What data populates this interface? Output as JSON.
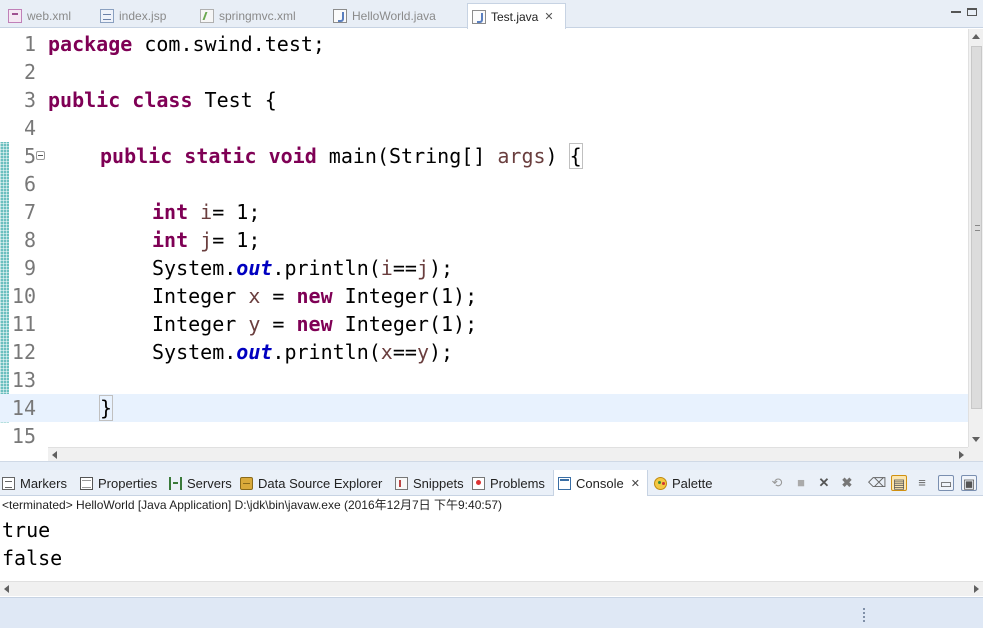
{
  "editor_tabs": [
    {
      "label": "web.xml",
      "icon": "xml-file-icon"
    },
    {
      "label": "index.jsp",
      "icon": "jsp-file-icon"
    },
    {
      "label": "springmvc.xml",
      "icon": "spring-xml-file-icon"
    },
    {
      "label": "HelloWorld.java",
      "icon": "java-file-icon"
    },
    {
      "label": "Test.java",
      "icon": "java-file-icon",
      "active": true,
      "close": "✕"
    }
  ],
  "code_lines": [
    {
      "num": "1"
    },
    {
      "num": "2"
    },
    {
      "num": "3"
    },
    {
      "num": "4"
    },
    {
      "num": "5"
    },
    {
      "num": "6"
    },
    {
      "num": "7"
    },
    {
      "num": "8"
    },
    {
      "num": "9"
    },
    {
      "num": "10"
    },
    {
      "num": "11"
    },
    {
      "num": "12"
    },
    {
      "num": "13"
    },
    {
      "num": "14"
    },
    {
      "num": "15"
    }
  ],
  "code": {
    "l1_kw": "package",
    "l1_rest": " com.swind.test;",
    "l3_kw": "public class",
    "l3_rest": " Test {",
    "l5_kw": "public static void",
    "l5_rest1": " main(String[] ",
    "l5_var": "args",
    "l5_rest2": ") ",
    "l5_brace": "{",
    "l7_kw": "int",
    "l7_var": "i",
    "l7_rest": "= 1;",
    "l8_kw": "int",
    "l8_var": "j",
    "l8_rest": "= 1;",
    "l9_a": "System.",
    "l9_fld": "out",
    "l9_b": ".println(",
    "l9_v1": "i",
    "l9_c": "==",
    "l9_v2": "j",
    "l9_d": ");",
    "l10_a": "Integer ",
    "l10_var": "x",
    "l10_b": " = ",
    "l10_kw": "new",
    "l10_c": " Integer(1);",
    "l11_a": "Integer ",
    "l11_var": "y",
    "l11_b": " = ",
    "l11_kw": "new",
    "l11_c": " Integer(1);",
    "l12_a": "System.",
    "l12_fld": "out",
    "l12_b": ".println(",
    "l12_v1": "x",
    "l12_c": "==",
    "l12_v2": "y",
    "l12_d": ");",
    "l14_brace": "}"
  },
  "view_tabs": [
    {
      "label": "Markers",
      "icon": "markers-icon"
    },
    {
      "label": "Properties",
      "icon": "properties-icon"
    },
    {
      "label": "Servers",
      "icon": "servers-icon"
    },
    {
      "label": "Data Source Explorer",
      "icon": "data-source-explorer-icon"
    },
    {
      "label": "Snippets",
      "icon": "snippets-icon"
    },
    {
      "label": "Problems",
      "icon": "problems-icon"
    },
    {
      "label": "Console",
      "icon": "console-icon",
      "active": true,
      "close": "✕"
    },
    {
      "label": "Palette",
      "icon": "palette-icon"
    }
  ],
  "console": {
    "header": "<terminated> HelloWorld [Java Application] D:\\jdk\\bin\\javaw.exe (2016年12月7日 下午9:40:57)",
    "output": [
      "true",
      "false"
    ]
  },
  "colors": {
    "keyword": "#7f0055",
    "field": "#0000c0",
    "variable": "#6a3e3e",
    "current_line": "#e8f2fe"
  }
}
